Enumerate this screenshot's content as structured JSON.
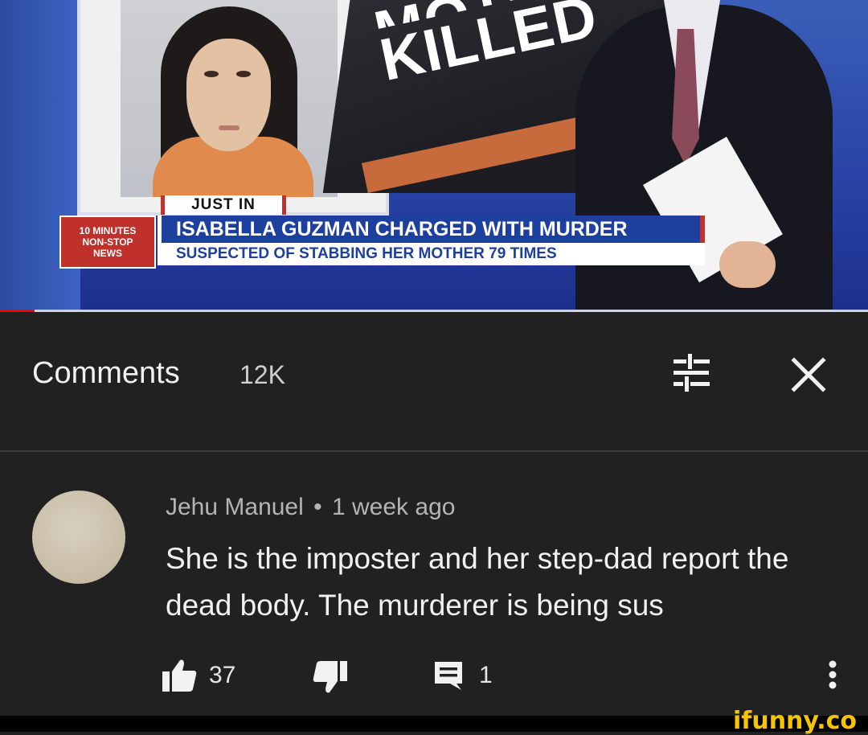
{
  "video": {
    "headline_top": "MOTHER",
    "headline_main": "KILLED",
    "badge": "JUST IN",
    "logo_lines": [
      "10 MINUTES",
      "NON-STOP",
      "NEWS"
    ],
    "ticker_title": "ISABELLA GUZMAN CHARGED WITH MURDER",
    "ticker_subtitle": "SUSPECTED OF STABBING HER MOTHER 79 TIMES",
    "progress_fraction": 0.04
  },
  "comments": {
    "title": "Comments",
    "count": "12K",
    "sort_icon": "sort-filter-icon",
    "close_icon": "close-icon"
  },
  "comment": {
    "author": "Jehu Manuel",
    "time": "1 week ago",
    "separator": "•",
    "text": "She is the imposter and her step-dad report the dead body. The murderer is being sus",
    "likes": "37",
    "replies": "1",
    "icons": [
      "thumbs-up-icon",
      "thumbs-down-icon",
      "reply-icon",
      "more-vertical-icon"
    ]
  },
  "footer": {
    "watermark": "ifunny.co"
  },
  "colors": {
    "background": "#212121",
    "progress": "#ff0000",
    "ticker_blue": "#1d3f9e",
    "news_red": "#c0312b",
    "watermark": "#f5c400"
  }
}
